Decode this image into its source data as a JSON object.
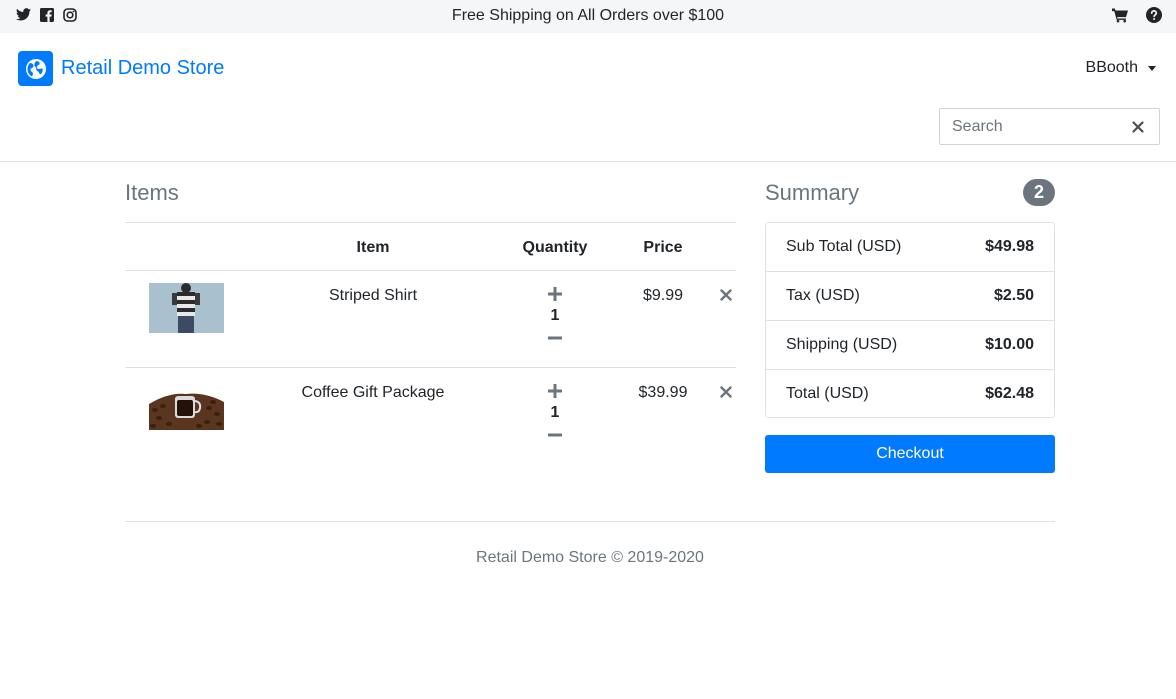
{
  "topbar": {
    "promo": "Free Shipping on All Orders over $100",
    "social_icons": [
      "twitter-icon",
      "facebook-icon",
      "instagram-icon"
    ],
    "right_icons": [
      "cart-icon",
      "help-icon"
    ]
  },
  "header": {
    "brand_name": "Retail Demo Store",
    "brand_icon": "globe-icon",
    "user_name": "BBooth",
    "search_placeholder": "Search"
  },
  "items": {
    "title": "Items",
    "columns": {
      "item": "Item",
      "quantity": "Quantity",
      "price": "Price"
    },
    "rows": [
      {
        "name": "Striped Shirt",
        "quantity": "1",
        "price": "$9.99",
        "image": "striped-shirt-thumbnail"
      },
      {
        "name": "Coffee Gift Package",
        "quantity": "1",
        "price": "$39.99",
        "image": "coffee-gift-thumbnail"
      }
    ]
  },
  "summary": {
    "title": "Summary",
    "badge": "2",
    "rows": [
      {
        "label": "Sub Total (USD)",
        "value": "$49.98"
      },
      {
        "label": "Tax (USD)",
        "value": "$2.50"
      },
      {
        "label": "Shipping (USD)",
        "value": "$10.00"
      },
      {
        "label": "Total (USD)",
        "value": "$62.48"
      }
    ],
    "checkout_label": "Checkout"
  },
  "footer": {
    "text": "Retail Demo Store © 2019-2020"
  },
  "colors": {
    "primary": "#007bff",
    "muted": "#6c757d",
    "topbar_bg": "#f5f6f8",
    "border": "#dee2e6"
  }
}
